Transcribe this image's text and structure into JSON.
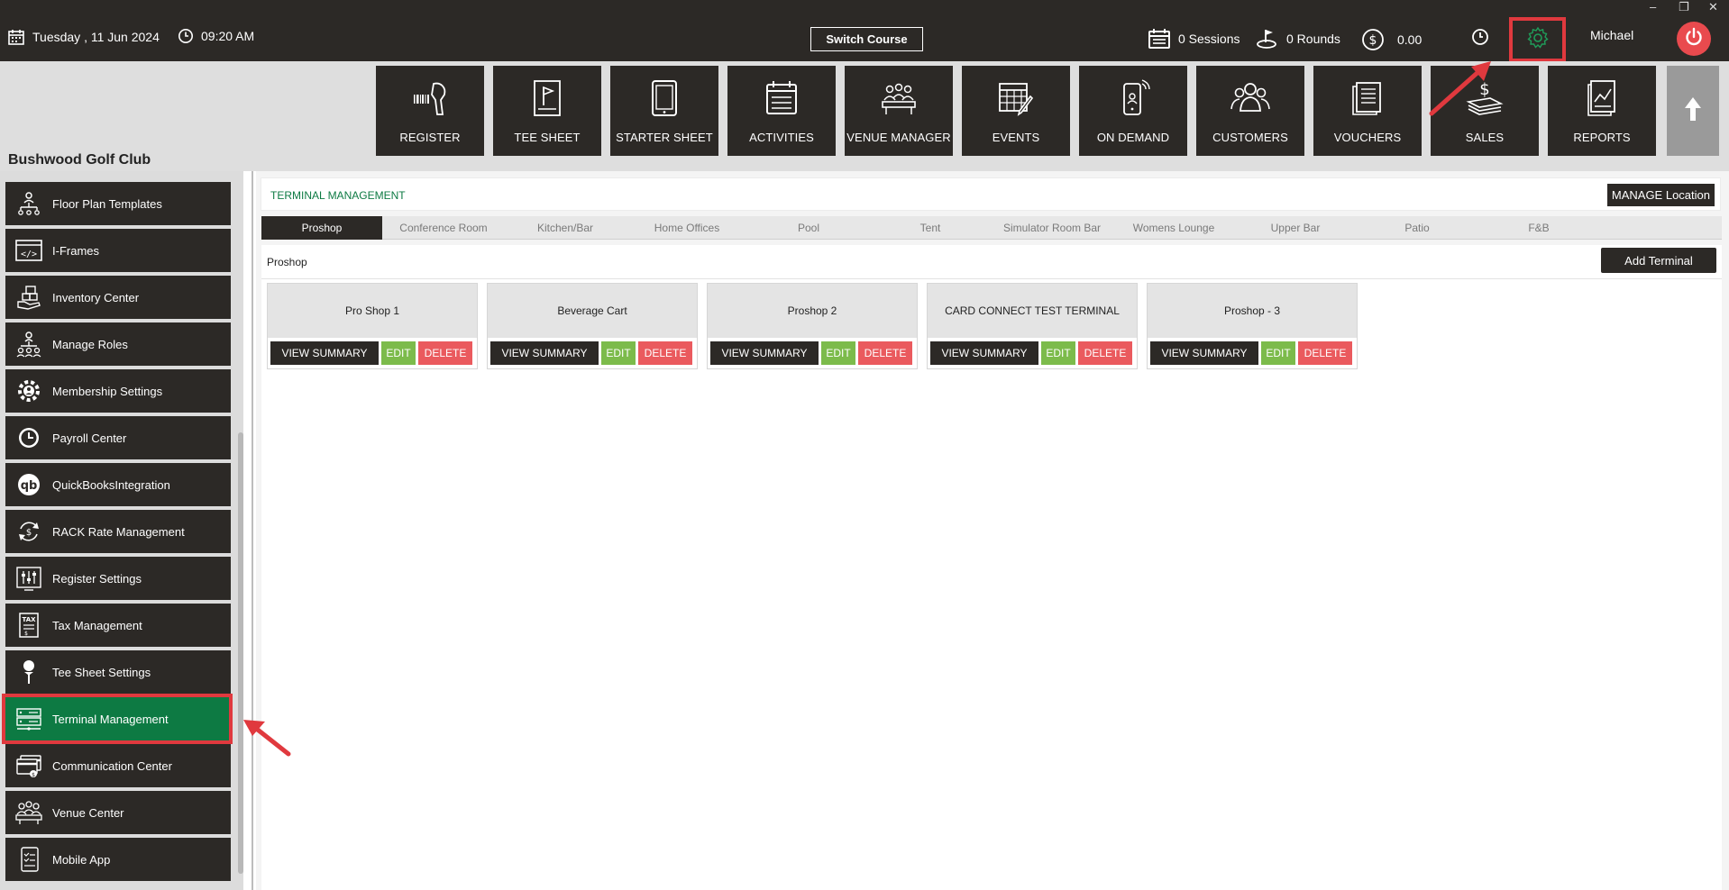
{
  "topbar": {
    "date": "Tuesday ,  11 Jun 2024",
    "time": "09:20 AM",
    "switch_course": "Switch Course",
    "sessions": "0 Sessions",
    "rounds": "0 Rounds",
    "amount": "0.00",
    "user": "Michael",
    "window": {
      "minimize": "–",
      "restore": "❐",
      "close": "✕"
    }
  },
  "club_name": "Bushwood Golf Club",
  "nav_tiles": [
    {
      "label": "REGISTER",
      "icon": "barcode-scanner-icon"
    },
    {
      "label": "TEE SHEET",
      "icon": "tee-sheet-flag-icon"
    },
    {
      "label": "STARTER SHEET",
      "icon": "tablet-icon"
    },
    {
      "label": "ACTIVITIES",
      "icon": "calendar-list-icon"
    },
    {
      "label": "VENUE MANAGER",
      "icon": "meeting-table-icon"
    },
    {
      "label": "EVENTS",
      "icon": "calendar-pencil-icon"
    },
    {
      "label": "ON DEMAND",
      "icon": "mobile-phone-icon"
    },
    {
      "label": "CUSTOMERS",
      "icon": "people-group-icon"
    },
    {
      "label": "VOUCHERS",
      "icon": "voucher-stack-icon"
    },
    {
      "label": "SALES",
      "icon": "money-stack-icon"
    },
    {
      "label": "REPORTS",
      "icon": "report-chart-icon"
    }
  ],
  "sidebar": {
    "items": [
      {
        "label": "Floor Plan Templates",
        "icon": "org-chart-icon"
      },
      {
        "label": "I-Frames",
        "icon": "code-window-icon"
      },
      {
        "label": "Inventory Center",
        "icon": "inventory-hand-icon"
      },
      {
        "label": "Manage Roles",
        "icon": "roles-tree-icon"
      },
      {
        "label": "Membership Settings",
        "icon": "membership-gear-icon"
      },
      {
        "label": "Payroll Center",
        "icon": "clock-icon"
      },
      {
        "label": "QuickBooksIntegration",
        "icon": "quickbooks-icon"
      },
      {
        "label": "RACK Rate Management",
        "icon": "rate-cycle-icon"
      },
      {
        "label": "Register Settings",
        "icon": "sliders-icon"
      },
      {
        "label": "Tax Management",
        "icon": "tax-document-icon"
      },
      {
        "label": "Tee Sheet Settings",
        "icon": "golf-tee-icon"
      },
      {
        "label": "Terminal Management",
        "icon": "terminal-server-icon",
        "active": true
      },
      {
        "label": "Communication Center",
        "icon": "communication-card-icon"
      },
      {
        "label": "Venue Center",
        "icon": "venue-people-icon"
      },
      {
        "label": "Mobile App",
        "icon": "mobile-app-icon"
      }
    ]
  },
  "terminal_management": {
    "title": "TERMINAL MANAGEMENT",
    "manage_location": "MANAGE Location",
    "tabs": [
      "Proshop",
      "Conference Room",
      "Kitchen/Bar",
      "Home Offices",
      "Pool",
      "Tent",
      "Simulator Room Bar",
      "Womens Lounge",
      "Upper Bar",
      "Patio",
      "F&B"
    ],
    "active_tab": "Proshop",
    "panel_title": "Proshop",
    "add_terminal": "Add Terminal",
    "terminals": [
      {
        "name": "Pro Shop 1"
      },
      {
        "name": "Beverage Cart"
      },
      {
        "name": "Proshop 2"
      },
      {
        "name": "CARD CONNECT TEST TERMINAL"
      },
      {
        "name": "Proshop - 3"
      }
    ],
    "buttons": {
      "view": "VIEW SUMMARY",
      "edit": "EDIT",
      "delete": "DELETE"
    }
  },
  "colors": {
    "dark": "#2c2926",
    "accent_green": "#0d7a43",
    "edit_green": "#7cbb4b",
    "delete_red": "#ea5a5e",
    "highlight_red": "#e0393e"
  }
}
